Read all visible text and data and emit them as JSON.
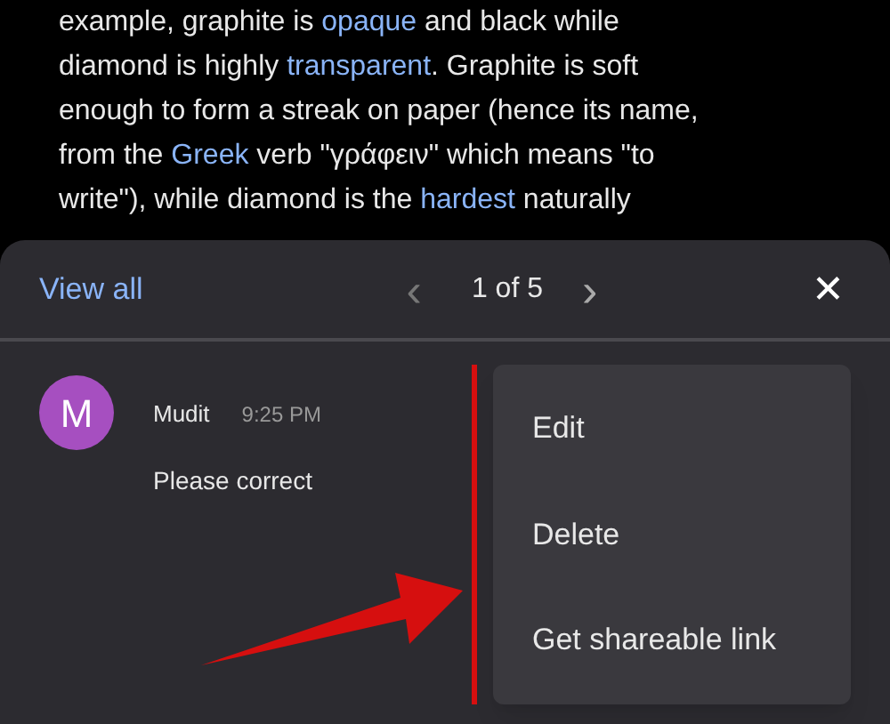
{
  "article": {
    "lines": [
      [
        {
          "text": "example, graphite is ",
          "link": false
        },
        {
          "text": "opaque",
          "link": true
        },
        {
          "text": " and black while",
          "link": false
        }
      ],
      [
        {
          "text": "diamond is highly ",
          "link": false
        },
        {
          "text": "transparent",
          "link": true
        },
        {
          "text": ". Graphite is soft",
          "link": false
        }
      ],
      [
        {
          "text": "enough to form a streak on paper (hence its name,",
          "link": false
        }
      ],
      [
        {
          "text": "from the ",
          "link": false
        },
        {
          "text": "Greek",
          "link": true
        },
        {
          "text": " verb \"γράφειν\" which means \"to",
          "link": false
        }
      ],
      [
        {
          "text": "write\"), while diamond is the ",
          "link": false
        },
        {
          "text": "hardest",
          "link": true
        },
        {
          "text": " naturally",
          "link": false
        }
      ]
    ]
  },
  "comments_panel": {
    "view_all": "View all",
    "prev": "‹",
    "counter": "1 of 5",
    "next": "›",
    "close": "✕",
    "comment": {
      "avatar_letter": "M",
      "author": "Mudit",
      "time": "9:25 PM",
      "text": "Please correct"
    }
  },
  "menu": {
    "items": [
      "Edit",
      "Delete",
      "Get shareable link"
    ]
  }
}
